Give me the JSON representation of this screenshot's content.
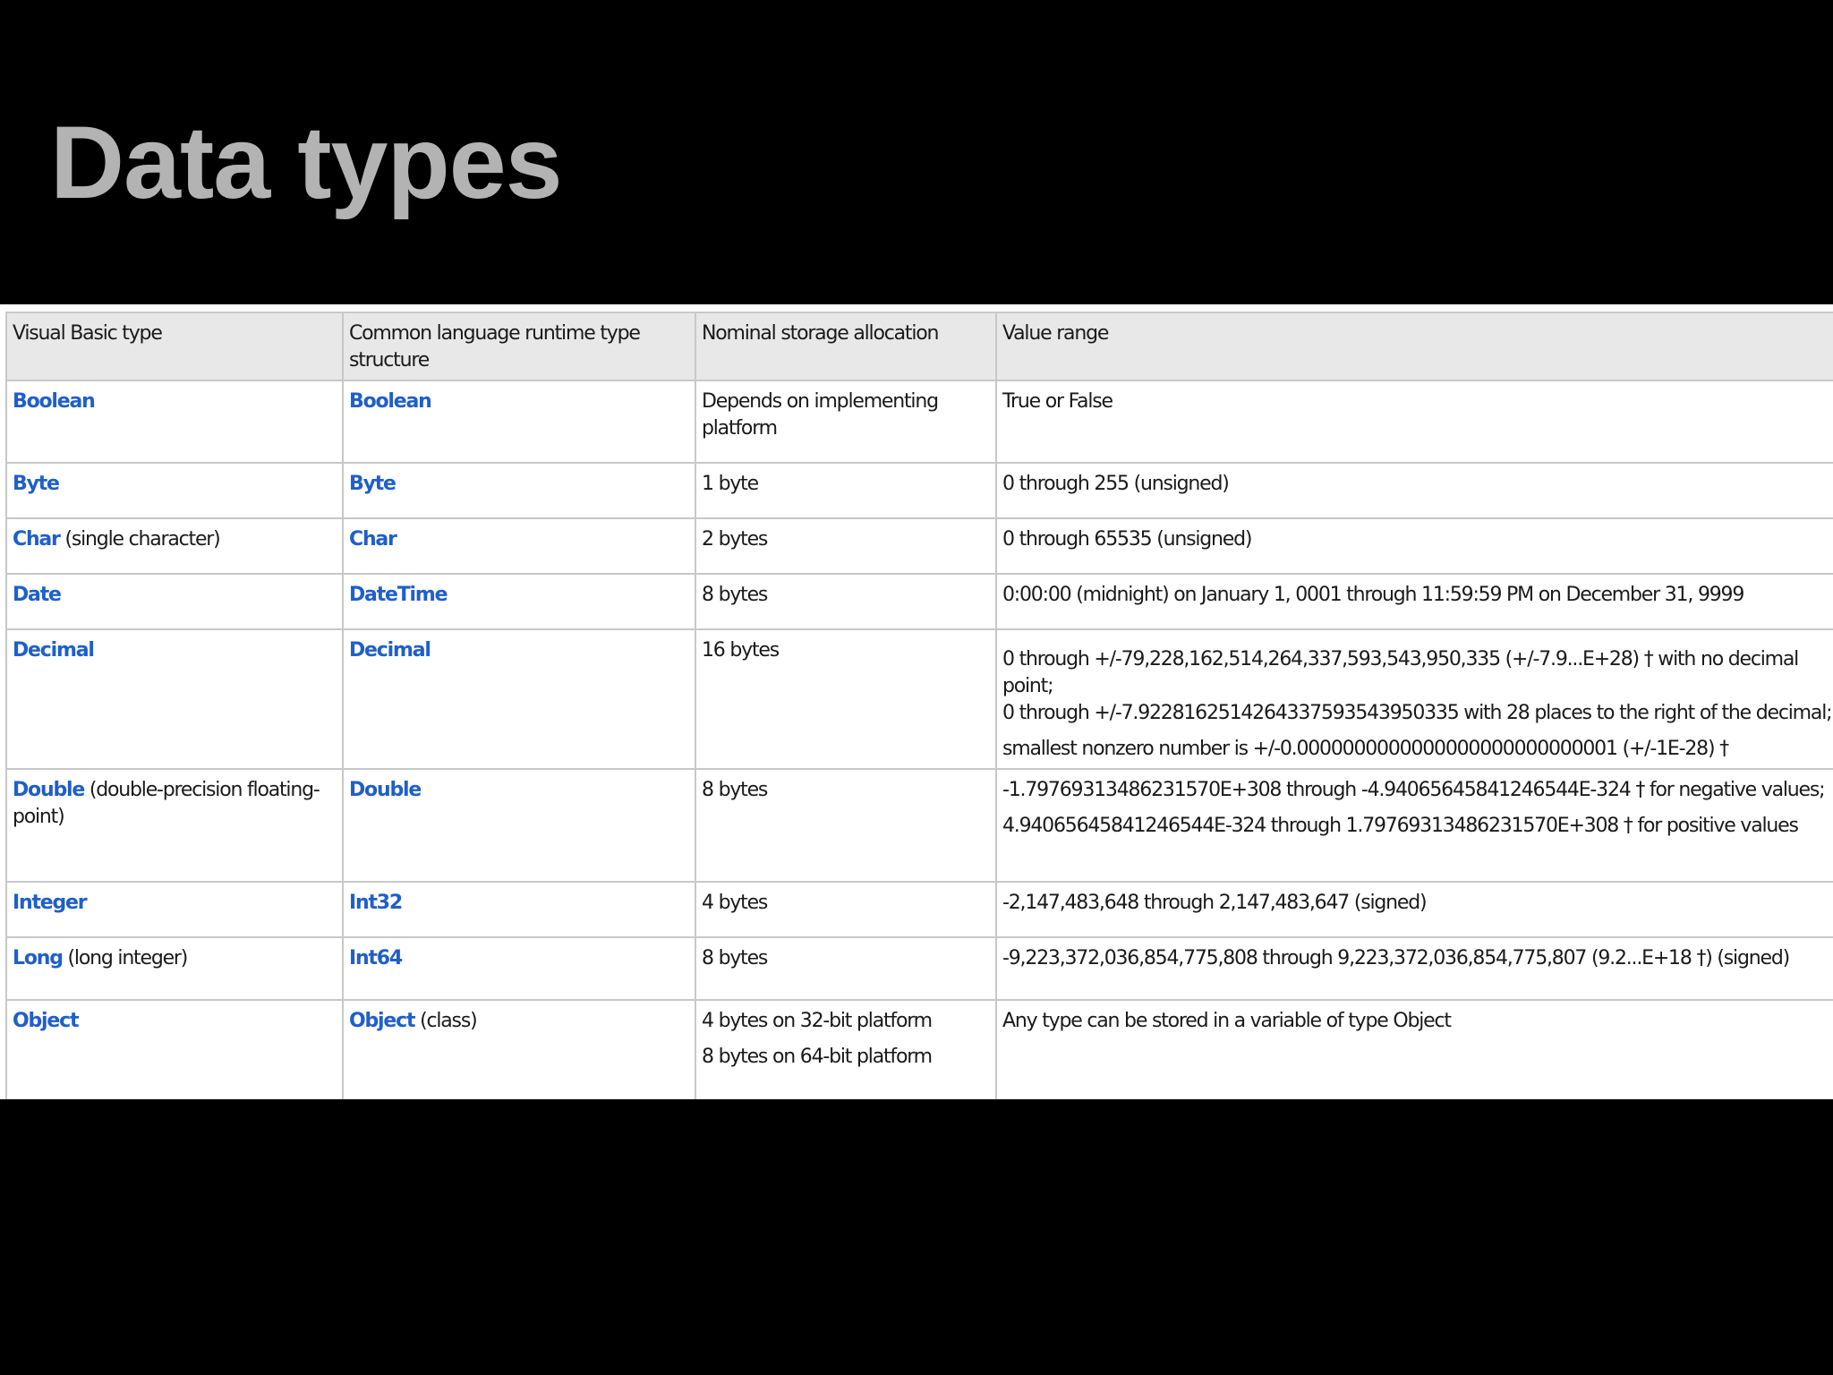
{
  "slide": {
    "title": "Data types"
  },
  "table": {
    "headers": [
      "Visual Basic type",
      "Common language runtime type structure",
      "Nominal storage allocation",
      "Value range"
    ],
    "rows": [
      {
        "vb": "Boolean",
        "vb_note": "",
        "clr": "Boolean",
        "clr_note": "",
        "storage": [
          "Depends on implementing platform"
        ],
        "range": [
          "True or False"
        ]
      },
      {
        "vb": "Byte",
        "vb_note": "",
        "clr": "Byte",
        "clr_note": "",
        "storage": [
          "1 byte"
        ],
        "range": [
          "0 through 255 (unsigned)"
        ]
      },
      {
        "vb": "Char",
        "vb_note": "(single character)",
        "clr": "Char",
        "clr_note": "",
        "storage": [
          "2 bytes"
        ],
        "range": [
          "0 through 65535 (unsigned)"
        ]
      },
      {
        "vb": "Date",
        "vb_note": "",
        "clr": "DateTime",
        "clr_note": "",
        "storage": [
          "8 bytes"
        ],
        "range": [
          "0:00:00 (midnight) on January 1, 0001 through 11:59:59 PM on December 31, 9999"
        ]
      },
      {
        "vb": "Decimal",
        "vb_note": "",
        "clr": "Decimal",
        "clr_note": "",
        "storage": [
          "16 bytes"
        ],
        "range": [
          "0 through +/-79,228,162,514,264,337,593,543,950,335 (+/-7.9...E+28) † with no decimal point;",
          "0 through +/-7.9228162514264337593543950335 with 28 places to the right of the decimal;",
          "smallest nonzero number is +/-0.0000000000000000000000000001 (+/-1E-28) †"
        ]
      },
      {
        "vb": "Double",
        "vb_note": "(double-precision floating-point)",
        "clr": "Double",
        "clr_note": "",
        "storage": [
          "8 bytes"
        ],
        "range": [
          "-1.79769313486231570E+308 through -4.94065645841246544E-324 † for negative values;",
          "4.94065645841246544E-324 through 1.79769313486231570E+308 † for positive values"
        ]
      },
      {
        "vb": "Integer",
        "vb_note": "",
        "clr": "Int32",
        "clr_note": "",
        "storage": [
          "4 bytes"
        ],
        "range": [
          "-2,147,483,648 through 2,147,483,647 (signed)"
        ]
      },
      {
        "vb": "Long",
        "vb_note": "(long integer)",
        "clr": "Int64",
        "clr_note": "",
        "storage": [
          "8 bytes"
        ],
        "range": [
          "-9,223,372,036,854,775,808 through 9,223,372,036,854,775,807 (9.2...E+18 †) (signed)"
        ]
      },
      {
        "vb": "Object",
        "vb_note": "",
        "clr": "Object",
        "clr_note": "(class)",
        "storage": [
          "4 bytes on 32-bit platform",
          "8 bytes on 64-bit platform"
        ],
        "range": [
          "Any type can be stored in a variable of type Object"
        ]
      }
    ]
  }
}
